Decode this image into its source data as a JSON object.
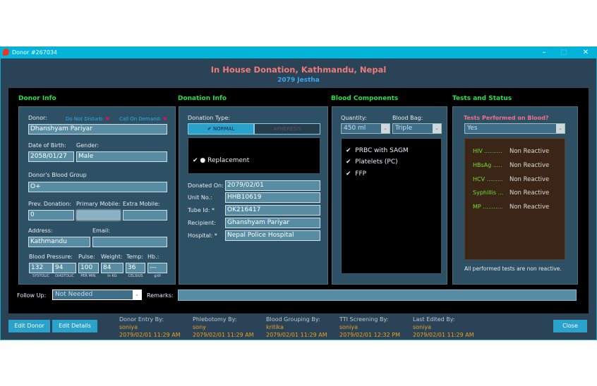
{
  "window": {
    "title": "Donor #267034"
  },
  "header": {
    "title": "In House Donation, Kathmandu, Nepal",
    "subtitle": "2079 Jestha"
  },
  "sections": {
    "donor": "Donor Info",
    "donation": "Donation Info",
    "components": "Blood Components",
    "tests": "Tests and Status"
  },
  "donor": {
    "donor_label": "Donor:",
    "dnd_label": "Do Not Disturb:",
    "cod_label": "Call On Demand:",
    "name": "Dhanshyam Pariyar",
    "dob_label": "Date of Birth:",
    "dob": "2058/01/27",
    "gender_label": "Gender:",
    "gender": "Male",
    "blood_group_label": "Donor's Blood Group",
    "blood_group": "O+",
    "prev_label": "Prev. Donation:",
    "prev": "0",
    "mobile_label": "Primary Mobile:",
    "extra_label": "Extra Mobile:",
    "extra": "",
    "address_label": "Address:",
    "address": "Kathmandu",
    "email_label": "Email:",
    "email": "",
    "bp_label": "Blood Pressure:",
    "pulse_label": "Pulse:",
    "weight_label": "Weight:",
    "temp_label": "Temp:",
    "hb_label": "Hb.:",
    "systolic": "132",
    "diastolic": "94",
    "pulse": "100",
    "weight": "84",
    "temp": "36",
    "hb": "---",
    "u_sys": "SYSTOLIC",
    "u_dia": "DIASTOLIC",
    "u_pulse": "PER MIN.",
    "u_weight": "In KG",
    "u_temp": "CELSIUS",
    "u_hb": "g/dl"
  },
  "donation": {
    "type_label": "Donation Type:",
    "normal": "NORMAL",
    "apheresis": "APHERESIS",
    "selected": "NORMAL",
    "replacement": "Replacement",
    "donated_on_label": "Donated On:",
    "donated_on": "2079/02/01",
    "unit_label": "Unit No.:",
    "unit": "HHB10619",
    "tube_label": "Tube Id: *",
    "tube": "OK216417",
    "recipient_label": "Recipient:",
    "recipient": "Ghanshyam Pariyar",
    "hospital_label": "Hospital: *",
    "hospital": "Nepal Police Hospital"
  },
  "components": {
    "quantity_label": "Quantity:",
    "quantity": "450 ml",
    "bag_label": "Blood Bag:",
    "bag": "Triple",
    "items": [
      "PRBC with SAGM",
      "Platelets (PC)",
      "FFP"
    ]
  },
  "tests": {
    "question": "Tests Performed on Blood?",
    "answer": "Yes",
    "results": [
      {
        "name": "HIV ..........",
        "value": "Non Reactive"
      },
      {
        "name": "HBsAg .....",
        "value": "Non Reactive"
      },
      {
        "name": "HCV .........",
        "value": "Non Reactive"
      },
      {
        "name": "Syphillis ...",
        "value": "Non Reactive"
      },
      {
        "name": "MP ...........",
        "value": "Non Reactive"
      }
    ],
    "summary": "All performed tests are non reactive."
  },
  "followup": {
    "label": "Follow Up:",
    "value": "Not Needed",
    "remarks_label": "Remarks:",
    "remarks": ""
  },
  "footer": {
    "edit_donor": "Edit Donor",
    "edit_details": "Edit Details",
    "close": "Close",
    "audit": [
      {
        "label": "Donor Entry By:",
        "user": "soniya",
        "time": "2079/02/01 11:29 AM"
      },
      {
        "label": "Phlebotomy By:",
        "user": "sony",
        "time": "2079/02/01 11:29 AM"
      },
      {
        "label": "Blood Grouping By:",
        "user": "kritika",
        "time": "2079/02/01 11:29 AM"
      },
      {
        "label": "TTI Screening By:",
        "user": "soniya",
        "time": "2079/02/01 12:32 PM"
      },
      {
        "label": "Last Edited By:",
        "user": "soniya",
        "time": "2079/02/01 11:29 AM"
      }
    ]
  },
  "colors": {
    "titlebar": "#00b4dc",
    "heading": "#f27a78",
    "section": "#23e044",
    "accent": "#2aa2cc",
    "audit_value": "#f0a020"
  }
}
